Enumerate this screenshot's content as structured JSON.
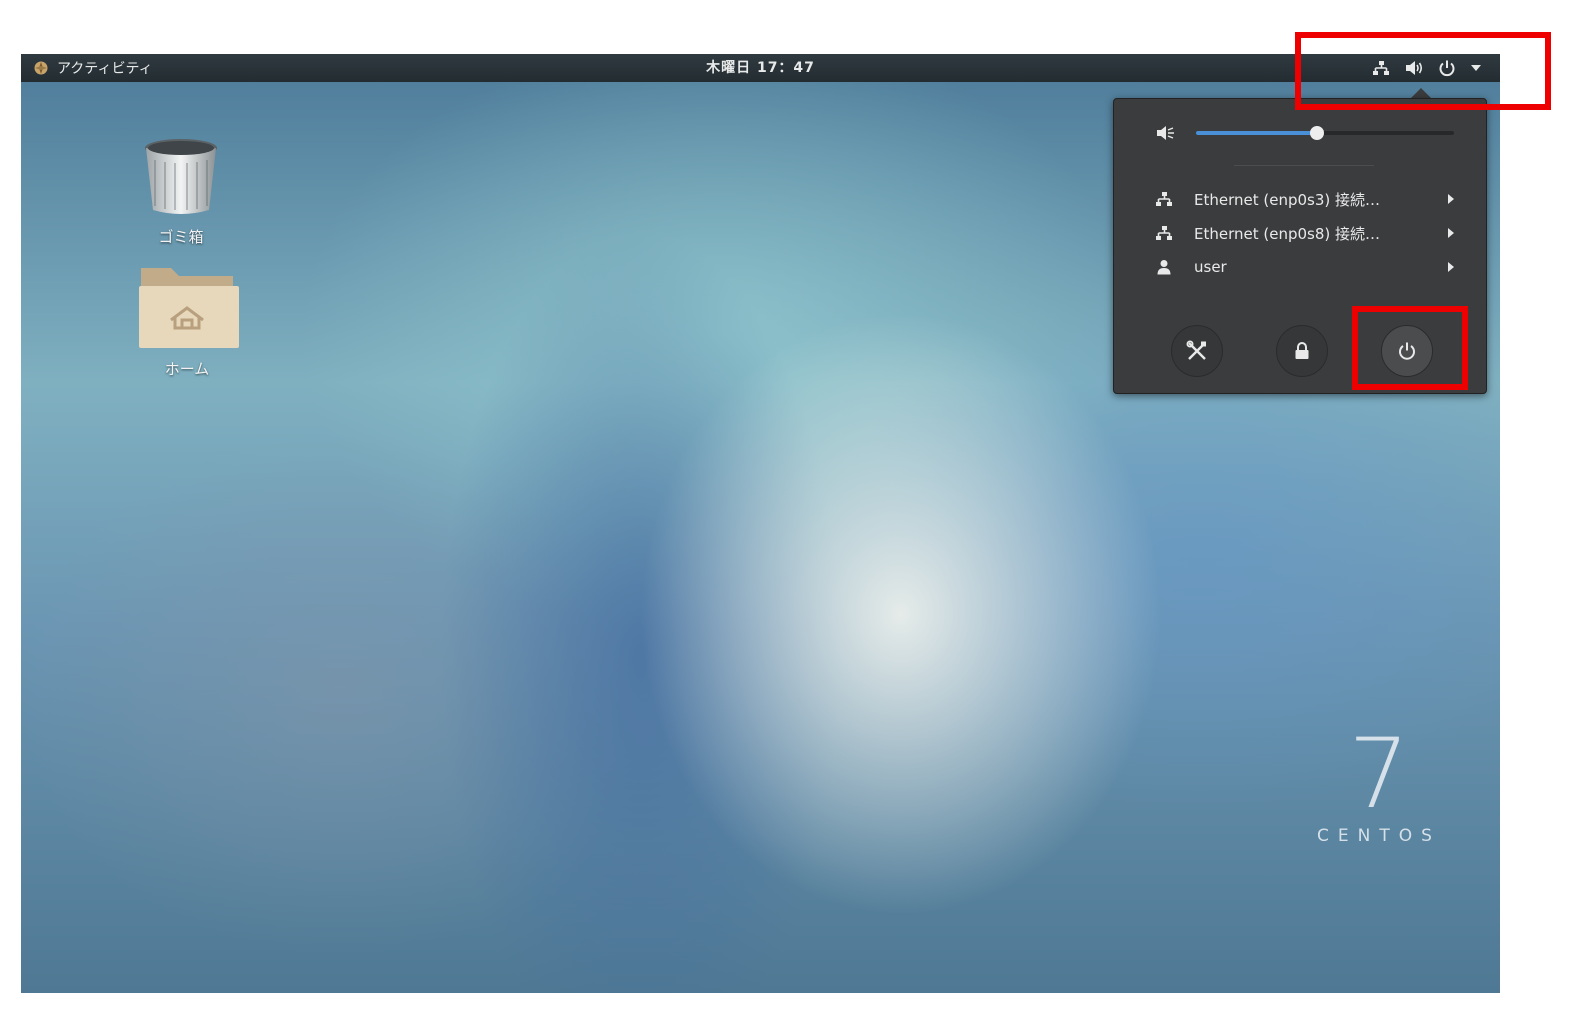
{
  "topbar": {
    "activities_label": "アクティビティ",
    "clock": "木曜日 17：47",
    "tray_icons": [
      "network-icon",
      "volume-icon",
      "power-icon",
      "dropdown-arrow-icon"
    ]
  },
  "desktop": {
    "icons": [
      {
        "label": "ゴミ箱",
        "icon": "trash-icon"
      },
      {
        "label": "ホーム",
        "icon": "home-folder-icon"
      }
    ],
    "watermark": {
      "number": "7",
      "word": "CENTOS"
    }
  },
  "system_menu": {
    "volume_level": 0.47,
    "items": [
      {
        "label": "Ethernet (enp0s3) 接続…",
        "icon": "network-icon"
      },
      {
        "label": "Ethernet (enp0s8) 接続…",
        "icon": "network-icon"
      },
      {
        "label": "user",
        "icon": "user-icon"
      }
    ],
    "buttons": [
      "settings-icon",
      "lock-icon",
      "power-icon"
    ]
  },
  "highlight_color": "#ee0000",
  "accent_color": "#4a90d9"
}
